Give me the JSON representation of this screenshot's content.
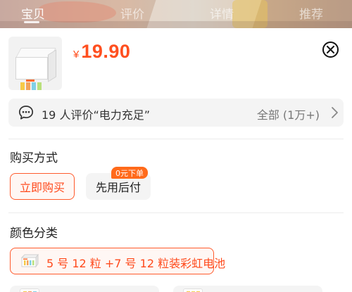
{
  "background_tabs": [
    {
      "label": "宝贝",
      "active": true
    },
    {
      "label": "评价",
      "active": false
    },
    {
      "label": "详情",
      "active": false
    },
    {
      "label": "推荐",
      "active": false
    }
  ],
  "product": {
    "currency": "¥",
    "price": "19.90",
    "thumbnail_icon": "battery-box-image"
  },
  "review": {
    "icon": "chat-bubble-icon",
    "summary": "19 人评价“电力充足”",
    "all_label": "全部 (1万+)",
    "chevron_icon": "chevron-right-icon"
  },
  "purchase_method": {
    "title": "购买方式",
    "options": [
      {
        "label": "立即购买",
        "selected": true
      },
      {
        "label": "先用后付",
        "selected": false,
        "badge": "0元下单"
      }
    ]
  },
  "color_category": {
    "title": "颜色分类",
    "options": [
      {
        "label": "5 号 12 粒 +7 号 12 粒装彩虹电池",
        "selected": true,
        "thumbnail_icon": "battery-box-image"
      }
    ]
  },
  "colors": {
    "accent": "#ff4f1f",
    "selected_bg": "#fff7f4",
    "badge_bg": "#ff6a1a",
    "chip_bg": "#f4f4f4"
  }
}
